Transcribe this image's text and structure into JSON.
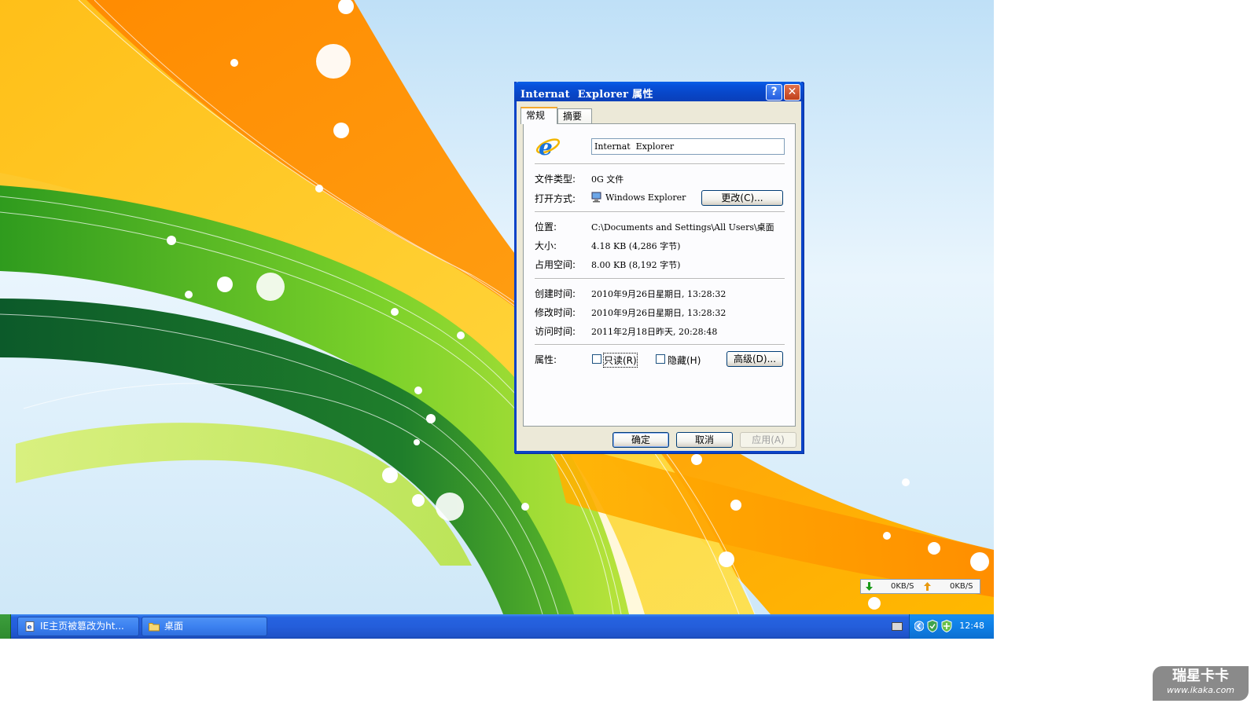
{
  "dialog": {
    "title": "Internat  Explorer 属性",
    "help_glyph": "?",
    "close_glyph": "✕",
    "tabs": [
      {
        "label": "常规",
        "active": true
      },
      {
        "label": "摘要",
        "active": false
      }
    ],
    "file_name": "Internat  Explorer",
    "rows": {
      "type": {
        "label": "文件类型:",
        "value": "0G 文件"
      },
      "opens_with": {
        "label": "打开方式:",
        "value": "Windows Explorer",
        "button": "更改(C)..."
      },
      "location": {
        "label": "位置:",
        "value": "C:\\Documents and Settings\\All Users\\桌面"
      },
      "size": {
        "label": "大小:",
        "value": "4.18 KB (4,286 字节)"
      },
      "size_on_disk": {
        "label": "占用空间:",
        "value": "8.00 KB (8,192 字节)"
      },
      "created": {
        "label": "创建时间:",
        "value": "2010年9月26日星期日, 13:28:32"
      },
      "modified": {
        "label": "修改时间:",
        "value": "2010年9月26日星期日, 13:28:32"
      },
      "accessed": {
        "label": "访问时间:",
        "value": "2011年2月18日昨天, 20:28:48"
      }
    },
    "attributes": {
      "label": "属性:",
      "readonly": {
        "label": "只读(R)",
        "checked": false
      },
      "hidden": {
        "label": "隐藏(H)",
        "checked": false
      },
      "advanced_button": "高级(D)..."
    },
    "footer": {
      "ok": "确定",
      "cancel": "取消",
      "apply": "应用(A)"
    }
  },
  "netspeed": {
    "down": "0KB/S",
    "up": "0KB/S",
    "down_color": "#1a9a1a",
    "up_color": "#e89a10"
  },
  "taskbar": {
    "items": [
      {
        "label": "IE主页被篡改为ht...",
        "icon": "html-document-icon"
      },
      {
        "label": "桌面",
        "icon": "folder-icon"
      }
    ],
    "clock": "12:48"
  },
  "watermark": {
    "brand": "瑞星卡卡",
    "url": "www.ikaka.com"
  },
  "colors": {
    "titlebar": "#0a4fd8",
    "taskbar": "#245edb",
    "tray": "#0f7fe6",
    "dialog_bg": "#ece9d8"
  }
}
